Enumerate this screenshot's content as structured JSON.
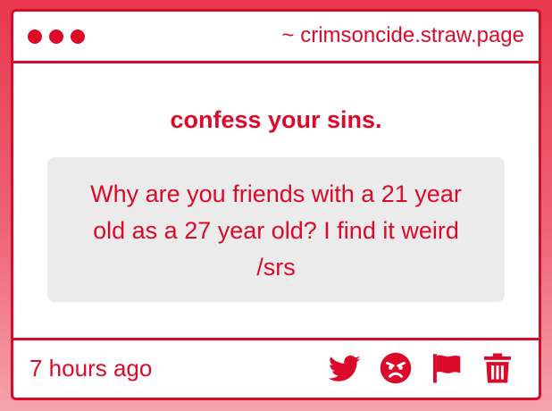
{
  "window": {
    "url": "~ crimsoncide.straw.page"
  },
  "content": {
    "title": "confess your sins.",
    "message": "Why are you friends with a 21 year old as a 27 year old? I find it weird /srs"
  },
  "footer": {
    "timestamp": "7 hours ago",
    "actions": [
      "twitter-icon",
      "angry-face-icon",
      "flag-icon",
      "trash-icon"
    ]
  },
  "colors": {
    "accent": "#dc0a2a",
    "message_bg": "#ecebec",
    "background_top": "#e8374f",
    "background_bottom": "#f6a3ad"
  }
}
